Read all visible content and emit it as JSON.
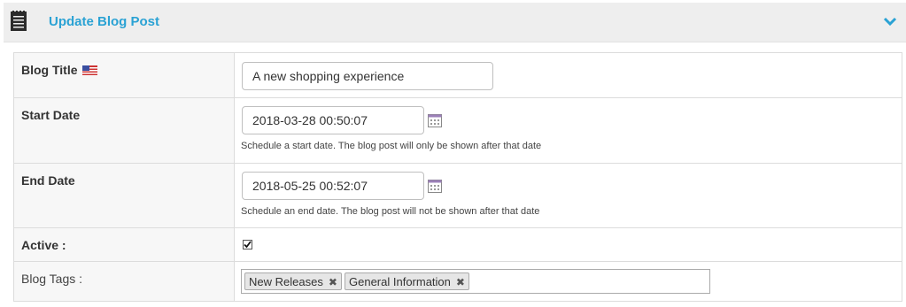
{
  "header": {
    "title": "Update Blog Post",
    "icon": "notepad-icon",
    "collapse_icon": "chevron-down-icon",
    "accent_color": "#2aa2d4"
  },
  "form": {
    "blog_title": {
      "label": "Blog Title",
      "flag_icon": "us-flag-icon",
      "value": "A new shopping experience"
    },
    "start_date": {
      "label": "Start Date",
      "value": "2018-03-28 00:50:07",
      "hint": "Schedule a start date. The blog post will only be shown after that date"
    },
    "end_date": {
      "label": "End Date",
      "value": "2018-05-25 00:52:07",
      "hint": "Schedule an end date. The blog post will not be shown after that date"
    },
    "active": {
      "label": "Active :",
      "checked": true
    },
    "blog_tags": {
      "label": "Blog Tags :",
      "tags": [
        "New Releases",
        "General Information"
      ],
      "remove_symbol": "✖"
    }
  }
}
